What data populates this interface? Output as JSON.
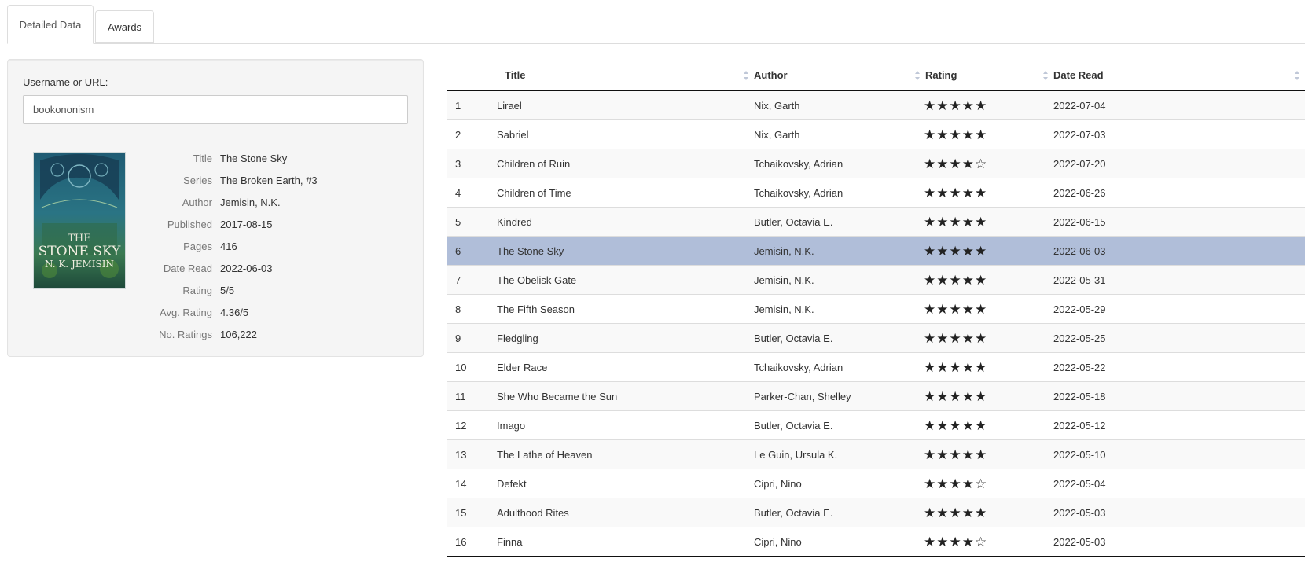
{
  "tabs": [
    {
      "label": "Detailed Data",
      "active": true
    },
    {
      "label": "Awards",
      "active": false
    }
  ],
  "user": {
    "label": "Username or URL:",
    "value": "bookononism"
  },
  "book": {
    "cover_title": "THE STONE SKY",
    "cover_author": "N.K. JEMISIN",
    "details": [
      {
        "key": "Title",
        "value": "The Stone Sky"
      },
      {
        "key": "Series",
        "value": "The Broken Earth, #3"
      },
      {
        "key": "Author",
        "value": "Jemisin, N.K."
      },
      {
        "key": "Published",
        "value": "2017-08-15"
      },
      {
        "key": "Pages",
        "value": "416"
      },
      {
        "key": "Date Read",
        "value": "2022-06-03"
      },
      {
        "key": "Rating",
        "value": "5/5"
      },
      {
        "key": "Avg. Rating",
        "value": "4.36/5"
      },
      {
        "key": "No. Ratings",
        "value": "106,222"
      }
    ]
  },
  "table": {
    "headers": {
      "num": "",
      "title": "Title",
      "author": "Author",
      "rating": "Rating",
      "date": "Date Read"
    },
    "selected_row": 6,
    "rows": [
      {
        "num": "1",
        "title": "Lirael",
        "author": "Nix, Garth",
        "stars": 5,
        "date": "2022-07-04"
      },
      {
        "num": "2",
        "title": "Sabriel",
        "author": "Nix, Garth",
        "stars": 5,
        "date": "2022-07-03"
      },
      {
        "num": "3",
        "title": "Children of Ruin",
        "author": "Tchaikovsky, Adrian",
        "stars": 4,
        "date": "2022-07-20"
      },
      {
        "num": "4",
        "title": "Children of Time",
        "author": "Tchaikovsky, Adrian",
        "stars": 5,
        "date": "2022-06-26"
      },
      {
        "num": "5",
        "title": "Kindred",
        "author": "Butler, Octavia E.",
        "stars": 5,
        "date": "2022-06-15"
      },
      {
        "num": "6",
        "title": "The Stone Sky",
        "author": "Jemisin, N.K.",
        "stars": 5,
        "date": "2022-06-03"
      },
      {
        "num": "7",
        "title": "The Obelisk Gate",
        "author": "Jemisin, N.K.",
        "stars": 5,
        "date": "2022-05-31"
      },
      {
        "num": "8",
        "title": "The Fifth Season",
        "author": "Jemisin, N.K.",
        "stars": 5,
        "date": "2022-05-29"
      },
      {
        "num": "9",
        "title": "Fledgling",
        "author": "Butler, Octavia E.",
        "stars": 5,
        "date": "2022-05-25"
      },
      {
        "num": "10",
        "title": "Elder Race",
        "author": "Tchaikovsky, Adrian",
        "stars": 5,
        "date": "2022-05-22"
      },
      {
        "num": "11",
        "title": "She Who Became the Sun",
        "author": "Parker-Chan, Shelley",
        "stars": 5,
        "date": "2022-05-18"
      },
      {
        "num": "12",
        "title": "Imago",
        "author": "Butler, Octavia E.",
        "stars": 5,
        "date": "2022-05-12"
      },
      {
        "num": "13",
        "title": "The Lathe of Heaven",
        "author": "Le Guin, Ursula K.",
        "stars": 5,
        "date": "2022-05-10"
      },
      {
        "num": "14",
        "title": "Defekt",
        "author": "Cipri, Nino",
        "stars": 4,
        "date": "2022-05-04"
      },
      {
        "num": "15",
        "title": "Adulthood Rites",
        "author": "Butler, Octavia E.",
        "stars": 5,
        "date": "2022-05-03"
      },
      {
        "num": "16",
        "title": "Finna",
        "author": "Cipri, Nino",
        "stars": 4,
        "date": "2022-05-03"
      }
    ]
  }
}
